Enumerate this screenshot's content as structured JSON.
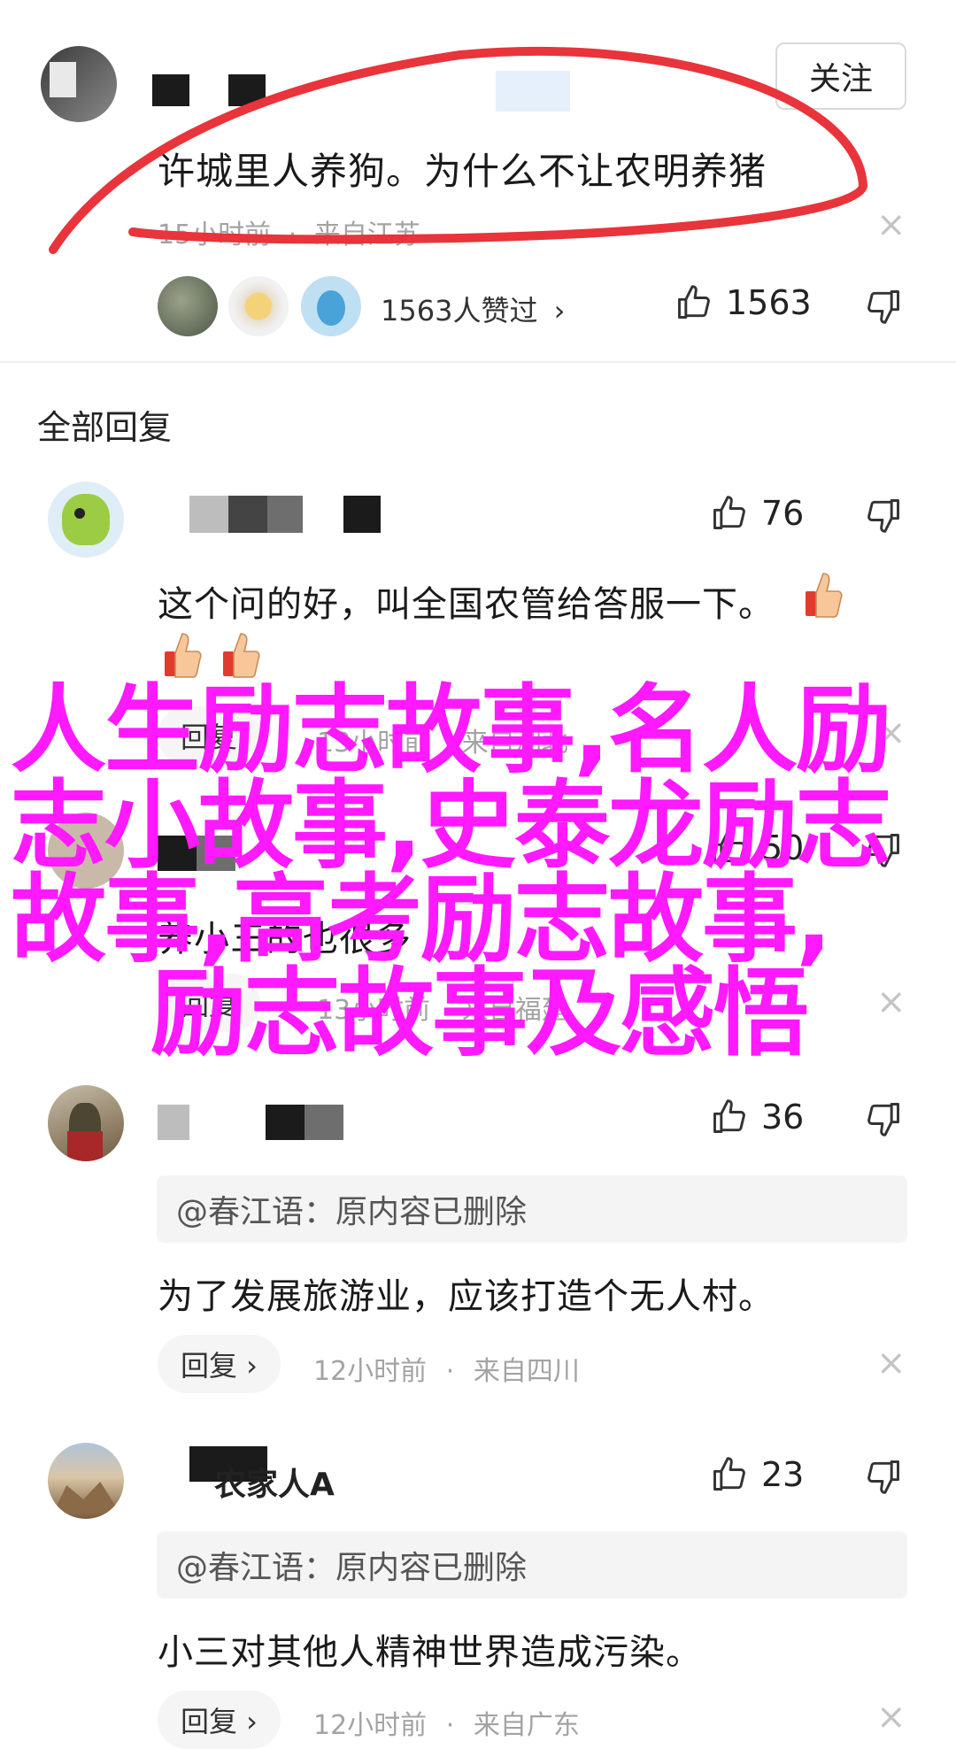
{
  "top_comment": {
    "follow_label": "关注",
    "text": "许城里人养狗。为什么不让农明养猪",
    "time": "15小时前",
    "sep": "·",
    "location": "来自江苏",
    "likers_text": "1563人赞过",
    "likers_chevron": "›",
    "like_count": "1563",
    "close_symbol": "×"
  },
  "section_title": "全部回复",
  "replies": [
    {
      "likes": "76",
      "text_line1": "这个问的好，叫全国农管给答服一下。",
      "reply_label": "回复",
      "time": "13小时前",
      "location": "来自湖北",
      "close_symbol": "×"
    },
    {
      "likes": "50",
      "text_line1": "养小三的也很多",
      "reply_label": "回复",
      "time": "13小时前",
      "location": "来自福建",
      "close_symbol": "×"
    },
    {
      "likes": "36",
      "quote": "@春江语：原内容已删除",
      "text_line1": "为了发展旅游业，应该打造个无人村。",
      "reply_label": "回复 ›",
      "time": "12小时前",
      "sep": "·",
      "location": "来自四川",
      "close_symbol": "×"
    },
    {
      "username_partial": "农家人A",
      "likes": "23",
      "quote": "@春江语：原内容已删除",
      "text_line1": "小三对其他人精神世界造成污染。",
      "reply_label": "回复 ›",
      "time": "12小时前",
      "sep": "·",
      "location": "来自广东",
      "close_symbol": "×"
    }
  ],
  "overlay": {
    "line1": "人生励志故事,名人励",
    "line2": "志小故事,史泰龙励志",
    "line3": "故事,高考励志故事,",
    "line4": "励志故事及感悟",
    "color": "#ff19ff"
  },
  "annotation": {
    "color": "#e8343a"
  }
}
